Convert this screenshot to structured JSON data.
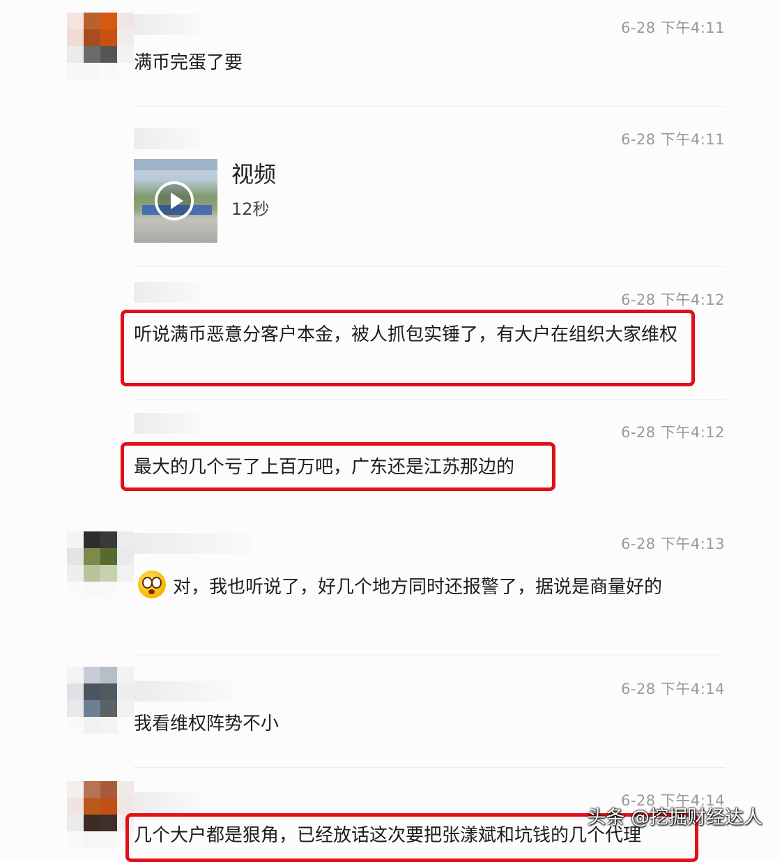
{
  "messages": [
    {
      "time": "6-28 下午4:11",
      "text": "满币完蛋了要"
    },
    {
      "time": "6-28 下午4:11",
      "video": {
        "title": "视频",
        "duration": "12秒"
      }
    },
    {
      "time": "6-28 下午4:12",
      "text": "听说满币恶意分客户本金，被人抓包实锤了，有大户在组织大家维权"
    },
    {
      "time": "6-28 下午4:12",
      "text": "最大的几个亏了上百万吧，广东还是江苏那边的"
    },
    {
      "time": "6-28 下午4:13",
      "text": "对，我也听说了，好几个地方同时还报警了，据说是商量好的"
    },
    {
      "time": "6-28 下午4:14",
      "text": "我看维权阵势不小"
    },
    {
      "time": "6-28 下午4:14",
      "text": "几个大户都是狠角，已经放话这次要把张漾斌和坑钱的几个代理"
    }
  ],
  "watermark": "头条 @挖掘财经达人",
  "colors": {
    "highlight": "#e10f1a",
    "timestamp": "#9a9a9a",
    "background": "#fdfcfd"
  }
}
